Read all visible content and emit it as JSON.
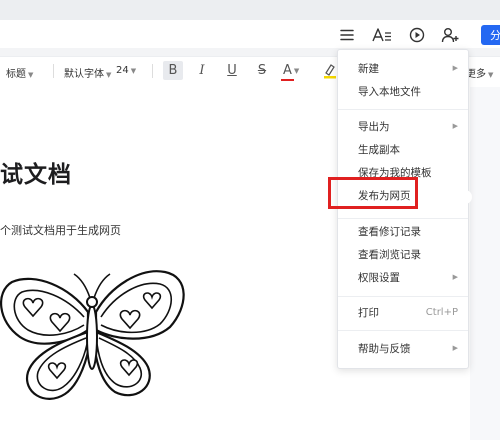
{
  "toolbar": {
    "style_label": "标题",
    "font_label": "默认字体",
    "size_label": "24",
    "more_label": "更多",
    "bold_glyph": "B",
    "italic_glyph": "I",
    "underline_glyph": "U",
    "strike_glyph": "S",
    "fontcolor_glyph": "A"
  },
  "header": {
    "share_label": "分"
  },
  "document": {
    "title": "试文档",
    "body": "个测试文档用于生成网页"
  },
  "menu": {
    "new": "新建",
    "import_local": "导入本地文件",
    "export_as": "导出为",
    "duplicate": "生成副本",
    "save_as_template": "保存为我的模板",
    "publish_as_webpage": "发布为网页",
    "revision_history": "查看修订记录",
    "view_history": "查看浏览记录",
    "permissions": "权限设置",
    "print": "打印",
    "print_shortcut": "Ctrl+P",
    "help_feedback": "帮助与反馈"
  },
  "colors": {
    "accent": "#2468f2",
    "highlight_box": "#e02020",
    "font_color_bar": "#e02020",
    "highlighter": "#f5d800"
  }
}
